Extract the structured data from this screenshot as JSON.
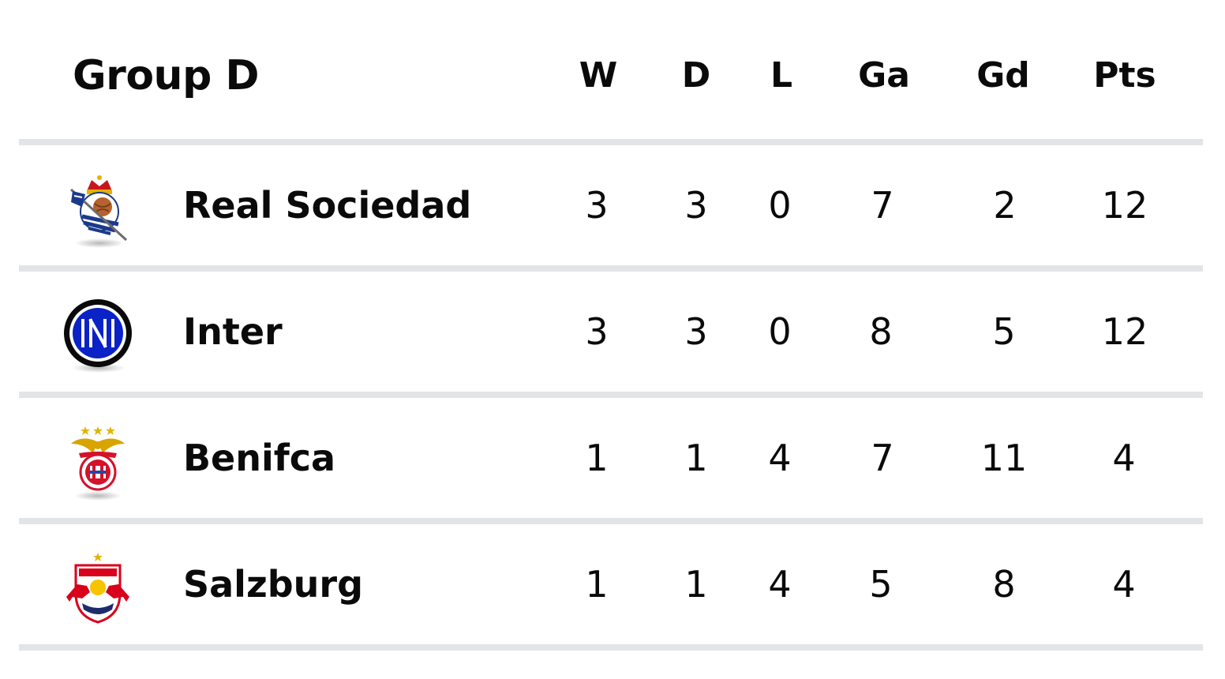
{
  "title": "Group D",
  "headers": {
    "w": "W",
    "d": "D",
    "l": "L",
    "ga": "Ga",
    "gd": "Gd",
    "pts": "Pts"
  },
  "rows": [
    {
      "team": "Real Sociedad",
      "crest_icon": "real-sociedad-crest-icon",
      "w": "3",
      "d": "3",
      "l": "0",
      "ga": "7",
      "gd": "2",
      "pts": "12"
    },
    {
      "team": "Inter",
      "crest_icon": "inter-crest-icon",
      "w": "3",
      "d": "3",
      "l": "0",
      "ga": "8",
      "gd": "5",
      "pts": "12"
    },
    {
      "team": "Benifca",
      "crest_icon": "benfica-crest-icon",
      "w": "1",
      "d": "1",
      "l": "4",
      "ga": "7",
      "gd": "11",
      "pts": "4"
    },
    {
      "team": "Salzburg",
      "crest_icon": "salzburg-crest-icon",
      "w": "1",
      "d": "1",
      "l": "4",
      "ga": "5",
      "gd": "8",
      "pts": "4"
    }
  ],
  "colors": {
    "divider": "#e2e5e8",
    "text": "#0a0a0a",
    "inter_blue": "#0b22c6",
    "redbull_red": "#d9001b"
  }
}
